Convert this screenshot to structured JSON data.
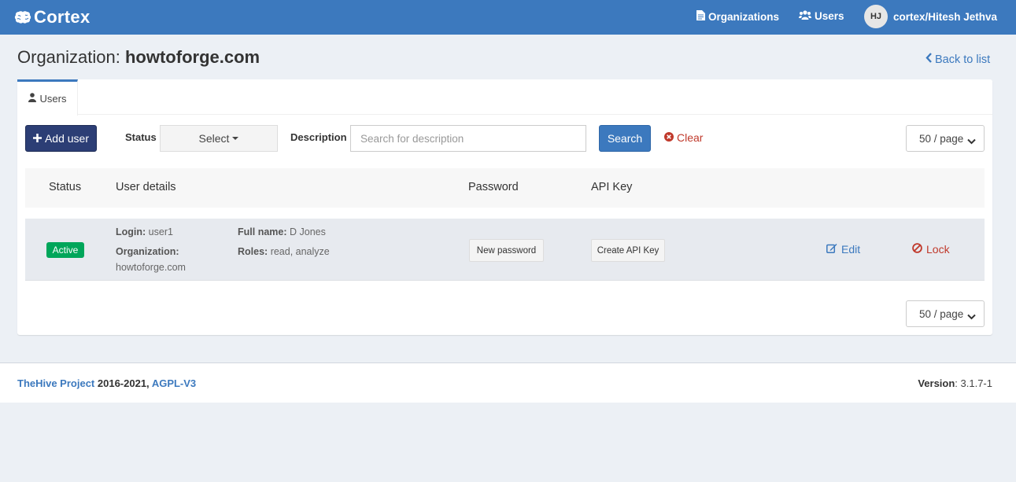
{
  "navbar": {
    "brand": "Cortex",
    "organizations": "Organizations",
    "users": "Users",
    "user_initials": "HJ",
    "user_name": "cortex/Hitesh Jethva",
    "background": "#3c79be"
  },
  "header": {
    "title_prefix": "Organization:",
    "org_name": "howtoforge.com",
    "back_link": "Back to list"
  },
  "tabs": [
    {
      "label": "Users",
      "active": true
    }
  ],
  "filters": {
    "add_user": "Add user",
    "status_label": "Status",
    "status_select": "Select",
    "description_label": "Description",
    "description_placeholder": "Search for description",
    "search_button": "Search",
    "clear": "Clear",
    "per_page": "50 / page"
  },
  "table": {
    "headers": {
      "status": "Status",
      "user_details": "User details",
      "password": "Password",
      "api_key": "API Key"
    },
    "rows": [
      {
        "status": "Active",
        "login_label": "Login:",
        "login": "user1",
        "org_label": "Organization:",
        "organization": "howtoforge.com",
        "fullname_label": "Full name:",
        "full_name": "D Jones",
        "roles_label": "Roles:",
        "roles": "read, analyze",
        "new_password": "New password",
        "create_api_key": "Create API Key",
        "edit": "Edit",
        "lock": "Lock"
      }
    ]
  },
  "footer": {
    "project": "TheHive Project",
    "years": "2016-2021,",
    "license": "AGPL-V3",
    "version_label": "Version",
    "version": ": 3.1.7-1"
  }
}
